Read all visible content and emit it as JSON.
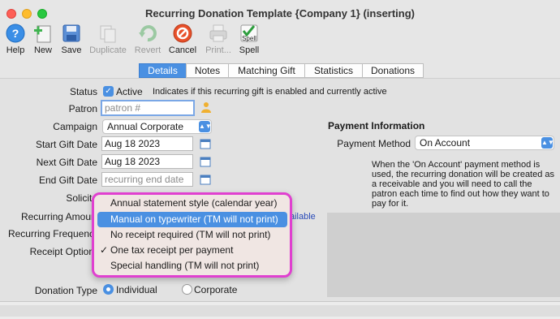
{
  "window": {
    "title": "Recurring Donation Template {Company 1} (inserting)"
  },
  "toolbar": {
    "help": "Help",
    "new": "New",
    "save": "Save",
    "duplicate": "Duplicate",
    "revert": "Revert",
    "cancel": "Cancel",
    "print": "Print...",
    "spell": "Spell",
    "spell_icon_text": "Spell"
  },
  "tabs": [
    "Details",
    "Notes",
    "Matching Gift",
    "Statistics",
    "Donations"
  ],
  "form": {
    "status_label": "Status",
    "active_label": "Active",
    "active_note": "Indicates if this recurring gift is enabled and currently active",
    "patron_label": "Patron",
    "patron_placeholder": "patron #",
    "campaign_label": "Campaign",
    "campaign_value": "Annual Corporate",
    "start_label": "Start Gift Date",
    "start_value": "Aug 18 2023",
    "next_label": "Next Gift Date",
    "next_value": "Aug 18 2023",
    "end_label": "End Gift Date",
    "end_placeholder": "recurring end date",
    "solicitor_label": "Solicito",
    "recurring_amount_label": "Recurring Amour",
    "available_partial": "ailable",
    "recurring_freq_label": "Recurring Frequenc",
    "receipt_label": "Receipt Option",
    "donation_type_label": "Donation Type",
    "individual": "Individual",
    "corporate": "Corporate"
  },
  "payment": {
    "heading": "Payment Information",
    "method_label": "Payment Method",
    "method_value": "On Account",
    "description": "When the 'On Account' payment method is used, the recurring donation will be created as a receivable and you will need to call the patron each time to find out how they want to pay for it."
  },
  "receipt_menu": {
    "items": [
      "Annual statement style (calendar year)",
      "Manual on typewriter (TM will not print)",
      "No receipt required (TM will not print)",
      "One tax receipt per payment",
      "Special handling (TM will not print)"
    ],
    "checkmark": "✓",
    "checked_index": 3,
    "highlighted_index": 1
  }
}
